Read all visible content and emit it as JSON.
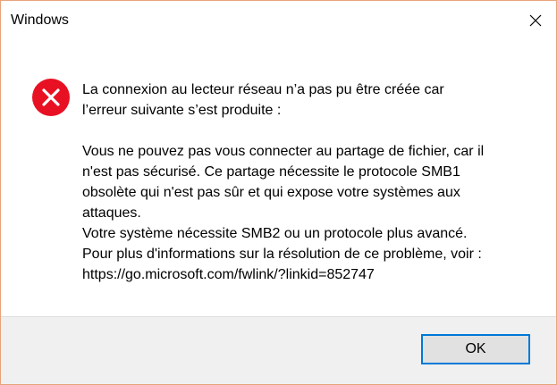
{
  "window": {
    "title": "Windows"
  },
  "dialog": {
    "icon": "error-icon",
    "message_lines": [
      "La connexion au lecteur réseau n’a pas pu être créée car\nl’erreur suivante s’est produite :",
      "Vous ne pouvez pas vous connecter au partage de fichier, car il\nn'est pas sécurisé. Ce partage nécessite le protocole SMB1\nobsolète qui n'est pas sûr et qui expose votre systèmes aux\nattaques.\nVotre système nécessite SMB2 ou un protocole plus avancé.\nPour plus d'informations sur la résolution de ce problème, voir :\nhttps://go.microsoft.com/fwlink/?linkid=852747"
    ]
  },
  "buttons": {
    "ok_label": "OK"
  },
  "colors": {
    "error_red": "#e81123",
    "focus_blue": "#0078d7",
    "border_orange": "#e8a37a",
    "footer_bg": "#f0f0f0"
  }
}
